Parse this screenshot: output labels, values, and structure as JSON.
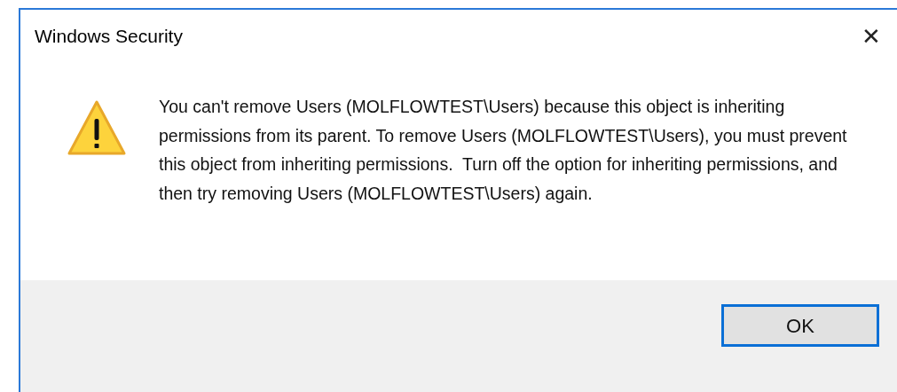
{
  "dialog": {
    "title": "Windows Security",
    "close": "✕",
    "message": "You can't remove Users (MOLFLOWTEST\\Users) because this object is inheriting permissions from its parent. To remove Users (MOLFLOWTEST\\Users), you must prevent this object from inheriting permissions.  Turn off the option for inheriting permissions, and then try removing Users (MOLFLOWTEST\\Users) again.",
    "buttons": [
      {
        "label": "OK",
        "default": true
      }
    ]
  }
}
